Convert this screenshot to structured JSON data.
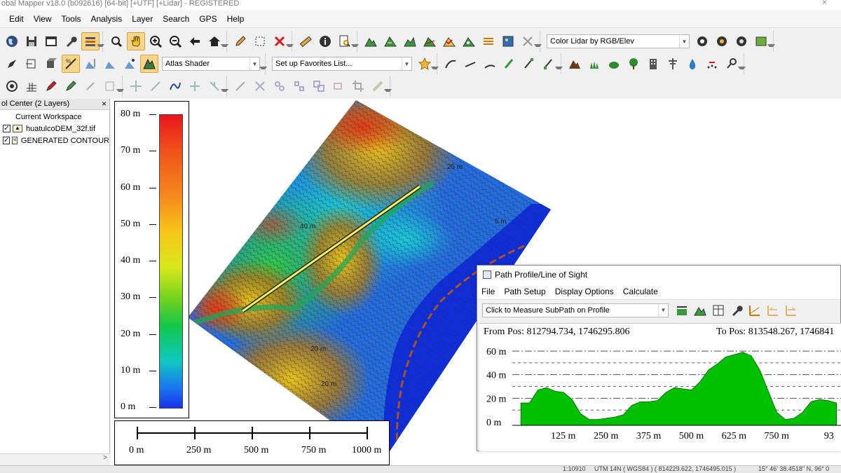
{
  "window": {
    "title": "obal Mapper v18.0 (b092616) [64-bit] [+UTF] [+Lidar] - REGISTERED",
    "close_glyph": "×"
  },
  "menu": [
    "Edit",
    "View",
    "Tools",
    "Analysis",
    "Layer",
    "Search",
    "GPS",
    "Help"
  ],
  "toolbar": {
    "lidar_combo": "Color Lidar by RGB/Elev",
    "shader_combo": "Atlas Shader",
    "favorites_combo": "Set up Favorites List..."
  },
  "control_center": {
    "title": "ol Center (2 Layers)",
    "close_glyph": "×",
    "workspace": "Current Workspace",
    "layers": [
      {
        "name": "huatulcoDEM_32f.tif",
        "checked": true
      },
      {
        "name": "GENERATED CONTOUR",
        "checked": true
      }
    ],
    "scroll_arrow": ">"
  },
  "legend": {
    "labels": [
      "80 m",
      "70 m",
      "60 m",
      "50 m",
      "40 m",
      "30 m",
      "20 m",
      "10 m",
      "0 m"
    ]
  },
  "scalebar": {
    "labels": [
      "0 m",
      "250 m",
      "500 m",
      "750 m",
      "1000 m"
    ]
  },
  "map": {
    "contour_labels": [
      "5 m",
      "20 m",
      "25 m",
      "40 m",
      "20 m"
    ]
  },
  "profile": {
    "title": "Path Profile/Line of Sight",
    "menu": [
      "File",
      "Path Setup",
      "Display Options",
      "Calculate"
    ],
    "mode_combo": "Click to Measure SubPath on Profile",
    "from_pos": "From Pos: 812794.734, 1746295.806",
    "to_pos": "To Pos: 813548.267, 1746841",
    "fill_color": "#00c000",
    "chart_data": {
      "type": "area",
      "x": [
        0,
        25,
        50,
        75,
        100,
        125,
        150,
        175,
        200,
        225,
        250,
        275,
        300,
        325,
        350,
        375,
        400,
        425,
        450,
        475,
        500,
        525,
        550,
        575,
        600,
        625,
        650,
        675,
        700,
        725,
        750,
        775,
        800,
        825,
        850,
        875,
        900,
        925
      ],
      "y": [
        16,
        16,
        27,
        29,
        26,
        25,
        19,
        7,
        2,
        2,
        3,
        4,
        6,
        14,
        17,
        17,
        18,
        25,
        29,
        28,
        27,
        34,
        44,
        49,
        55,
        57,
        59,
        56,
        44,
        26,
        8,
        2,
        3,
        8,
        17,
        19,
        18,
        16
      ],
      "xlim": [
        -25,
        940
      ],
      "ylim": [
        -3,
        63
      ],
      "yticks": [
        0,
        20,
        40,
        60
      ],
      "ytick_labels": [
        "0 m",
        "20 m",
        "40 m",
        "60 m"
      ],
      "xticks": [
        125,
        250,
        375,
        500,
        625,
        750,
        925
      ],
      "xtick_labels": [
        "125 m",
        "250 m",
        "375 m",
        "500 m",
        "625 m",
        "750 m",
        "93"
      ],
      "grid": true
    }
  },
  "status": {
    "scale": "1:10910",
    "coords": "UTM 14N ( WGS84 ) ( 814229.622, 1746495.015 )",
    "latlon": "15° 46' 38.4518\" N, 96° 0"
  }
}
